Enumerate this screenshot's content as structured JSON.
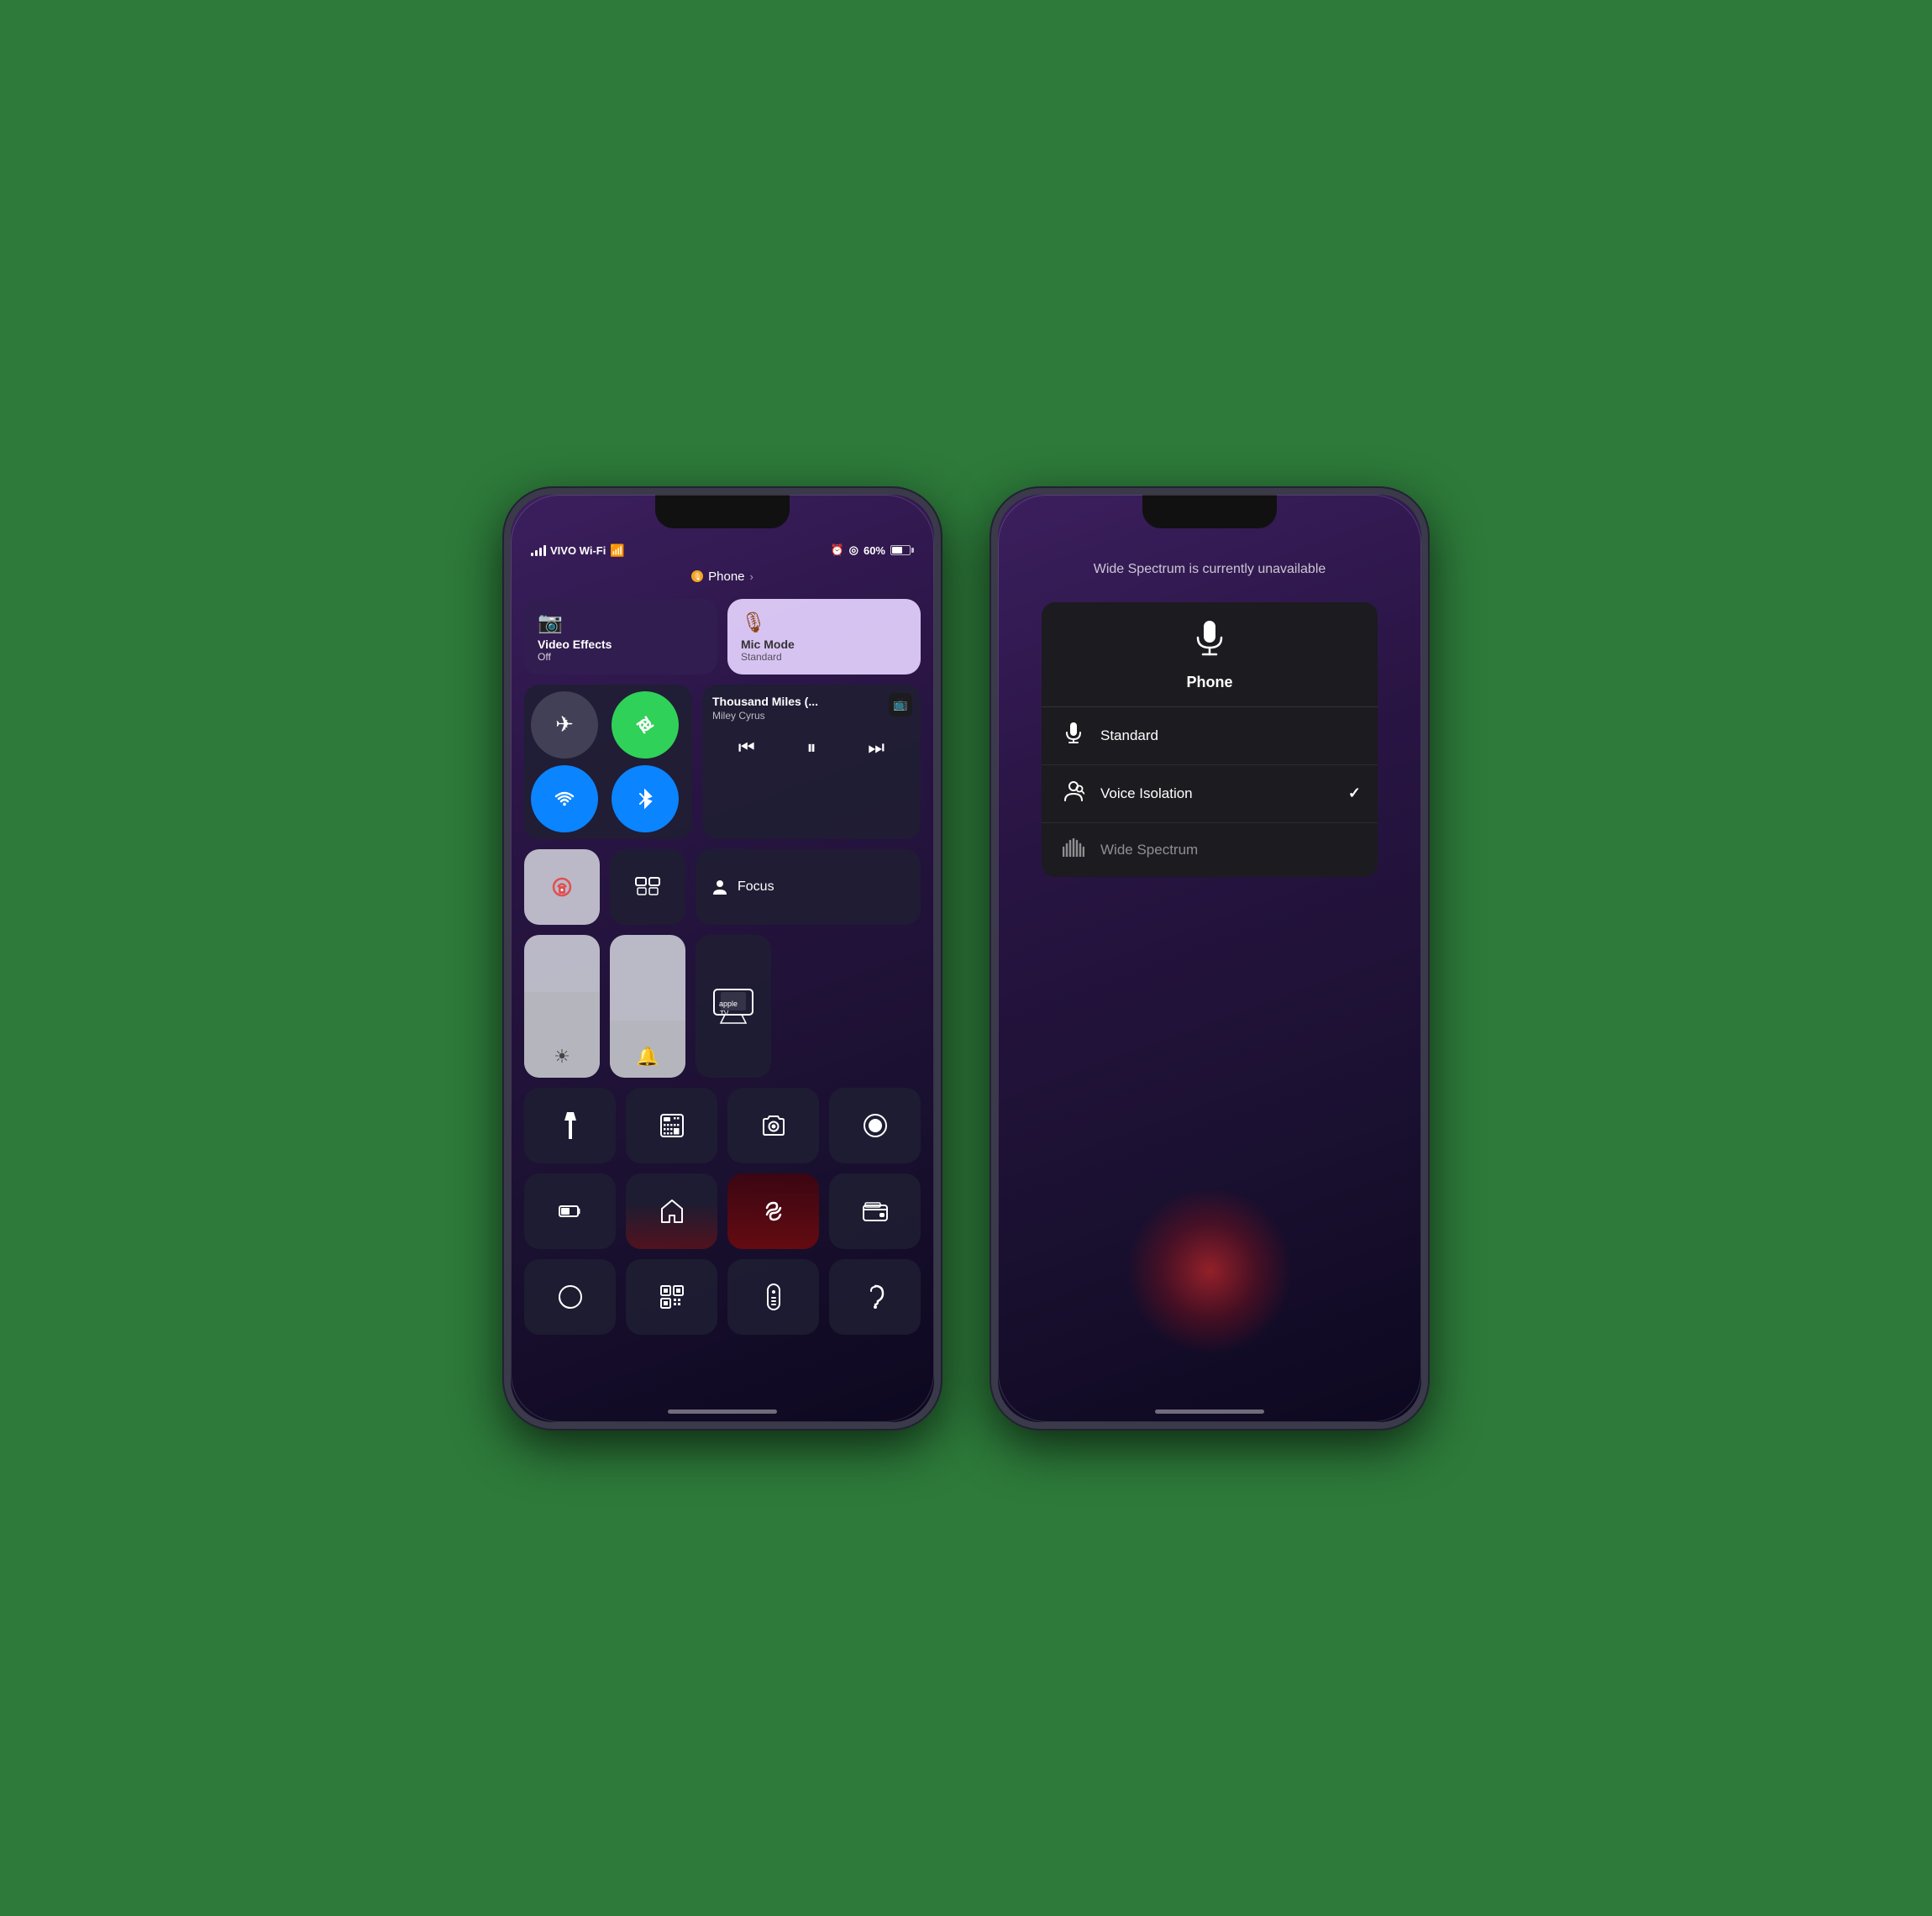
{
  "phones": {
    "left": {
      "status": {
        "carrier": "VIVO Wi-Fi",
        "battery": "60%",
        "alarmIcon": "⏰",
        "locationIcon": "◎"
      },
      "phoneIndicator": {
        "label": "Phone",
        "chevron": "›"
      },
      "videoEffects": {
        "title": "Video Effects",
        "subtitle": "Off",
        "icon": "📷"
      },
      "micMode": {
        "title": "Mic Mode",
        "subtitle": "Standard",
        "icon": "🎙"
      },
      "connectivity": {
        "airplane": "✈",
        "cellular": "📡",
        "wifi": "📶",
        "bluetooth": "🔵"
      },
      "media": {
        "title": "Thousand Miles (...",
        "artist": "Miley Cyrus",
        "appIcon": "📺",
        "prevBtn": "⏮",
        "pauseBtn": "⏸",
        "nextBtn": "⏭"
      },
      "lowerTiles": {
        "screenLock": "🔒",
        "mirror": "⊡",
        "focus": "Focus",
        "focusIcon": "👤"
      },
      "sliders": {
        "brightness": "☀",
        "appletv": "📺"
      },
      "grid1": [
        "🔦",
        "🔢",
        "📷",
        "⊙"
      ],
      "grid2": [
        "🔋",
        "🏠",
        "🎵",
        "💳"
      ],
      "grid3": [
        "◑",
        "▦",
        "📱",
        "👂"
      ]
    },
    "right": {
      "unavailableText": "Wide Spectrum is currently unavailable",
      "panel": {
        "icon": "🎙",
        "title": "Phone",
        "options": [
          {
            "icon": "🎙",
            "label": "Standard",
            "checked": false
          },
          {
            "icon": "👤",
            "label": "Voice Isolation",
            "checked": true
          },
          {
            "icon": "🎛",
            "label": "Wide Spectrum",
            "checked": false
          }
        ]
      }
    }
  }
}
